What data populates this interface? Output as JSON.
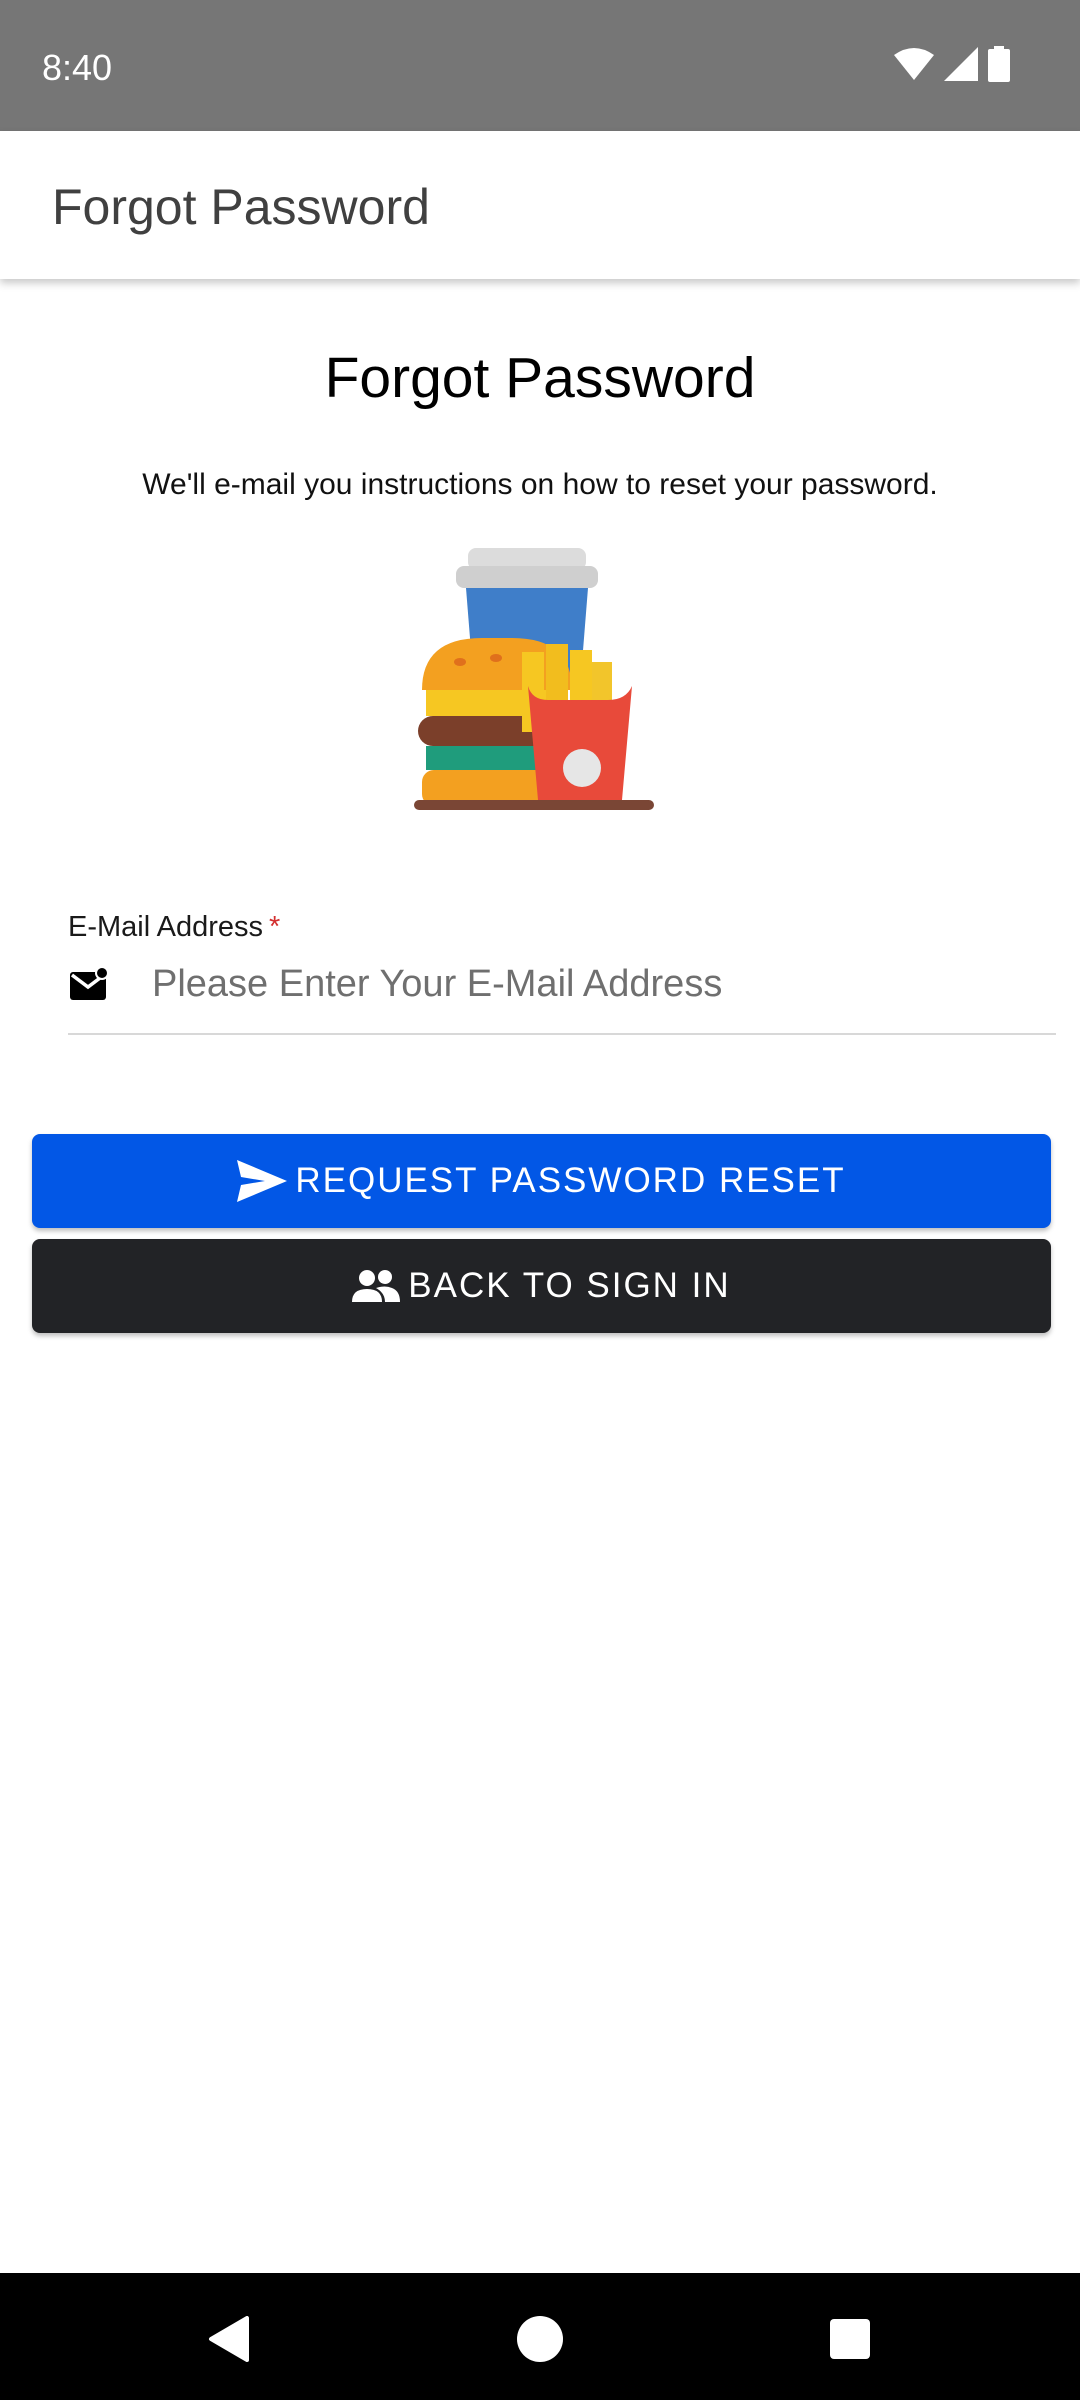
{
  "status_bar": {
    "time": "8:40",
    "icons": [
      "wifi-icon",
      "cellular-signal-icon",
      "battery-icon"
    ]
  },
  "app_bar": {
    "title": "Forgot Password"
  },
  "content": {
    "heading": "Forgot Password",
    "subtitle": "We'll e-mail you instructions on how to reset your password.",
    "illustration": "fast-food-illustration"
  },
  "email_field": {
    "label": "E-Mail Address",
    "required_marker": "*",
    "placeholder": "Please Enter Your E-Mail Address",
    "value": "",
    "icon": "mail-icon"
  },
  "buttons": {
    "request_reset": {
      "label": "REQUEST PASSWORD RESET",
      "icon": "send-icon",
      "color": "#0257e6"
    },
    "back_to_sign_in": {
      "label": "BACK TO SIGN IN",
      "icon": "people-icon",
      "color": "#222326"
    }
  },
  "nav_bar": {
    "items": [
      "back-icon",
      "home-icon",
      "recents-icon"
    ]
  },
  "colors": {
    "status_bar": "#767676",
    "primary": "#0257e6",
    "dark": "#222326",
    "required": "#d32f2f"
  }
}
